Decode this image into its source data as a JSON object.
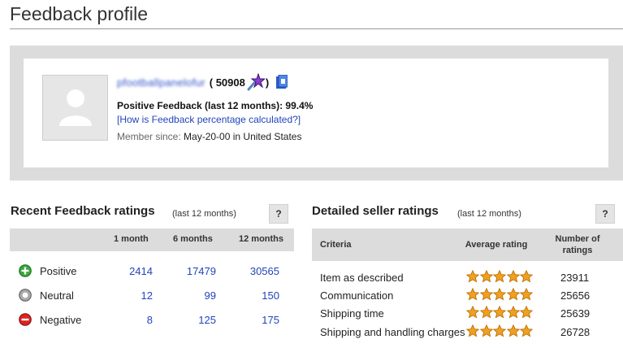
{
  "page": {
    "title": "Feedback profile"
  },
  "profile": {
    "username": "pfootballpanelofur",
    "score_display": "( 50908",
    "score_close": ")",
    "positive_feedback": "Positive Feedback (last 12 months): 99.4%",
    "how_link": "[How is Feedback percentage calculated?]",
    "member_since_label": "Member since:",
    "member_since_value": "May-20-00 in United States"
  },
  "recent": {
    "title": "Recent Feedback ratings",
    "subtitle": "(last 12 months)",
    "help": "?",
    "columns": [
      "1 month",
      "6 months",
      "12 months"
    ],
    "rows": [
      {
        "label": "Positive",
        "icon": "positive-icon",
        "values": [
          "2414",
          "17479",
          "30565"
        ]
      },
      {
        "label": "Neutral",
        "icon": "neutral-icon",
        "values": [
          "12",
          "99",
          "150"
        ]
      },
      {
        "label": "Negative",
        "icon": "negative-icon",
        "values": [
          "8",
          "125",
          "175"
        ]
      }
    ]
  },
  "detailed": {
    "title": "Detailed seller ratings",
    "subtitle": "(last 12 months)",
    "help": "?",
    "col_criteria": "Criteria",
    "col_average": "Average rating",
    "col_number_1": "Number of",
    "col_number_2": "ratings",
    "rows": [
      {
        "label": "Item as described",
        "stars": 5,
        "count": "23911"
      },
      {
        "label": "Communication",
        "stars": 5,
        "count": "25656"
      },
      {
        "label": "Shipping time",
        "stars": 5,
        "count": "25639"
      },
      {
        "label": "Shipping and handling charges",
        "stars": 5,
        "count": "26728"
      }
    ]
  },
  "colors": {
    "link": "#2244bb",
    "panel": "#dcdcdc",
    "star": "#f0a020",
    "positive": "#3aa63a",
    "negative": "#d22",
    "neutral": "#999"
  }
}
